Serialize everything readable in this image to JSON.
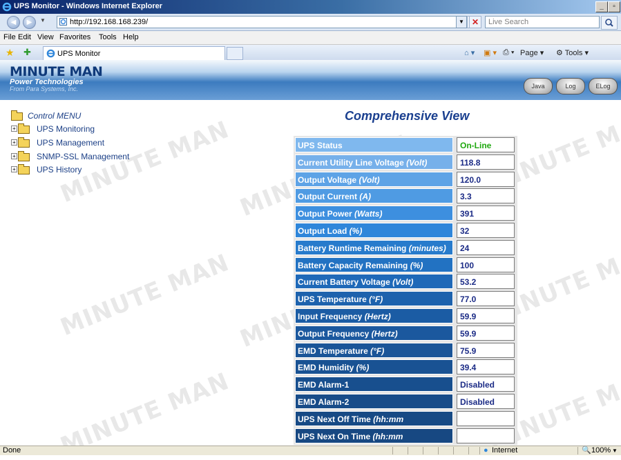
{
  "window": {
    "title": "UPS Monitor - Windows Internet Explorer"
  },
  "address_bar": {
    "url": "http://192.168.168.239/",
    "search_placeholder": "Live Search"
  },
  "menu": [
    "File",
    "Edit",
    "View",
    "Favorites",
    "Tools",
    "Help"
  ],
  "tab": {
    "title": "UPS Monitor"
  },
  "command_bar": {
    "page_label": "Page",
    "tools_label": "Tools"
  },
  "header": {
    "logo_main": "MINUTE MAN",
    "logo_sub": "Power Technologies",
    "logo_tag": "From Para Systems, Inc.",
    "buttons": [
      "Java",
      "Log",
      "ELog"
    ]
  },
  "nav": {
    "root": "Control MENU",
    "items": [
      "UPS Monitoring",
      "UPS Management",
      "SNMP-SSL Management",
      "UPS History"
    ]
  },
  "content": {
    "title": "Comprehensive View",
    "rows": [
      {
        "label": "UPS Status",
        "unit": "",
        "value": "On-Line",
        "shade": "#7fb8ee",
        "value_color": "#1fa80f"
      },
      {
        "label": "Current Utility Line Voltage ",
        "unit": "(Volt)",
        "value": "118.8",
        "shade": "#76b0ea"
      },
      {
        "label": "Output Voltage ",
        "unit": "(Volt)",
        "value": "120.0",
        "shade": "#5ea3e6"
      },
      {
        "label": "Output Current ",
        "unit": "(A)",
        "value": "3.3",
        "shade": "#4f9be3"
      },
      {
        "label": "Output Power ",
        "unit": "(Watts)",
        "value": "391",
        "shade": "#3d8fdf"
      },
      {
        "label": "Output Load ",
        "unit": "(%)",
        "value": "32",
        "shade": "#2f86da"
      },
      {
        "label": "Battery Runtime Remaining ",
        "unit": "(minutes)",
        "value": "24",
        "shade": "#277bcc"
      },
      {
        "label": "Battery Capacity Remaining ",
        "unit": "(%)",
        "value": "100",
        "shade": "#2272c2"
      },
      {
        "label": "Current Battery Voltage ",
        "unit": "(Volt)",
        "value": "53.2",
        "shade": "#1f69b8"
      },
      {
        "label": "UPS Temperature ",
        "unit": "(°F)",
        "value": "77.0",
        "shade": "#1d62ad"
      },
      {
        "label": "Input Frequency ",
        "unit": "(Hertz)",
        "value": "59.9",
        "shade": "#1b5ca4"
      },
      {
        "label": "Output Frequency ",
        "unit": "(Hertz)",
        "value": "59.9",
        "shade": "#1b589e"
      },
      {
        "label": "EMD Temperature ",
        "unit": "(°F)",
        "value": "75.9",
        "shade": "#1a5598"
      },
      {
        "label": "EMD Humidity ",
        "unit": "(%)",
        "value": "39.4",
        "shade": "#195293"
      },
      {
        "label": "EMD Alarm-1",
        "unit": "",
        "value": "Disabled",
        "shade": "#184f8e"
      },
      {
        "label": "EMD Alarm-2",
        "unit": "",
        "value": "Disabled",
        "shade": "#184c89"
      },
      {
        "label": "UPS Next Off Time ",
        "unit": "(hh:mm mm/dd/yyyy)",
        "value": "",
        "shade": "#174a85"
      },
      {
        "label": "UPS Next On Time ",
        "unit": "(hh:mm mm/dd/yyyy)",
        "value": "",
        "shade": "#174882"
      }
    ]
  },
  "watermark": "MINUTE MAN",
  "status_bar": {
    "left": "Done",
    "zone": "Internet",
    "zoom": "100%"
  }
}
